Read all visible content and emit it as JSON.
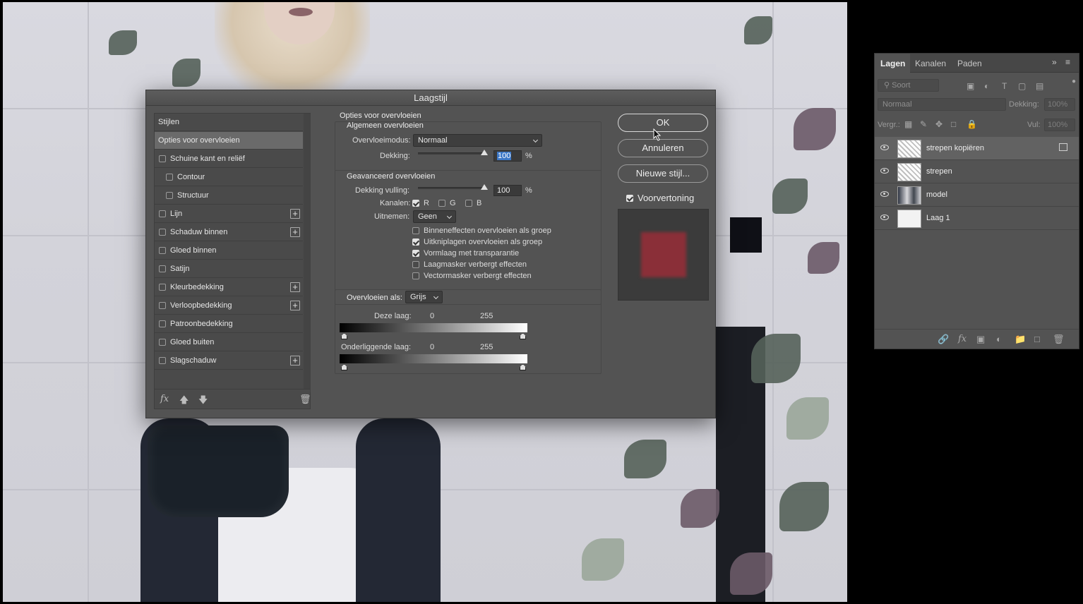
{
  "dialog": {
    "title": "Laagstijl",
    "styles": {
      "header": "Stijlen",
      "items": [
        {
          "label": "Opties voor overvloeien",
          "selected": true
        },
        {
          "label": "Schuine kant en reliëf",
          "checked": false
        },
        {
          "label": "Contour",
          "checked": false
        },
        {
          "label": "Structuur",
          "checked": false
        },
        {
          "label": "Lijn",
          "checked": false
        },
        {
          "label": "Schaduw binnen",
          "checked": false
        },
        {
          "label": "Gloed binnen",
          "checked": false
        },
        {
          "label": "Satijn",
          "checked": false
        },
        {
          "label": "Kleurbedekking",
          "checked": false
        },
        {
          "label": "Verloopbedekking",
          "checked": false
        },
        {
          "label": "Patroonbedekking",
          "checked": false
        },
        {
          "label": "Gloed buiten",
          "checked": false
        },
        {
          "label": "Slagschaduw",
          "checked": false
        }
      ],
      "footer_icons": [
        "fx-icon",
        "move-up-icon",
        "move-down-icon",
        "trash-icon"
      ],
      "fx_label": "fx"
    },
    "options": {
      "section_title": "Opties voor overvloeien",
      "general": {
        "title": "Algemeen overvloeien",
        "blend_mode_label": "Overvloeimodus:",
        "blend_mode_value": "Normaal",
        "opacity_label": "Dekking:",
        "opacity_value": "100",
        "opacity_unit": "%"
      },
      "advanced": {
        "title": "Geavanceerd overvloeien",
        "fill_opacity_label": "Dekking vulling:",
        "fill_opacity_value": "100",
        "fill_opacity_unit": "%",
        "channels_label": "Kanalen:",
        "channels": [
          {
            "label": "R",
            "checked": true
          },
          {
            "label": "G",
            "checked": false
          },
          {
            "label": "B",
            "checked": false
          }
        ],
        "knockout_label": "Uitnemen:",
        "knockout_value": "Geen",
        "checkboxes": [
          {
            "label": "Binneneffecten overvloeien als groep",
            "checked": false
          },
          {
            "label": "Uitkniplagen overvloeien als groep",
            "checked": true
          },
          {
            "label": "Vormlaag met transparantie",
            "checked": true
          },
          {
            "label": "Laagmasker verbergt effecten",
            "checked": false
          },
          {
            "label": "Vectormasker verbergt effecten",
            "checked": false
          }
        ]
      },
      "blend_if": {
        "label": "Overvloeien als:",
        "value": "Grijs",
        "this_layer_label": "Deze laag:",
        "this_layer_min": "0",
        "this_layer_max": "255",
        "underlying_label": "Onderliggende laag:",
        "underlying_min": "0",
        "underlying_max": "255"
      }
    },
    "buttons": {
      "ok": "OK",
      "cancel": "Annuleren",
      "new_style": "Nieuwe stijl..."
    },
    "preview": {
      "label": "Voorvertoning",
      "checked": true,
      "swatch_color": "#8a2f38"
    }
  },
  "layers_panel": {
    "tabs": [
      "Lagen",
      "Kanalen",
      "Paden"
    ],
    "active_tab": "Lagen",
    "filter_placeholder": "Soort",
    "blend_mode": "Normaal",
    "opacity_label": "Dekking:",
    "opacity_value": "100%",
    "lock_label": "Vergr.:",
    "fill_label": "Vul:",
    "fill_value": "100%",
    "layers": [
      {
        "name": "strepen kopiëren",
        "selected": true,
        "thumb": "pattern"
      },
      {
        "name": "strepen",
        "selected": false,
        "thumb": "pattern"
      },
      {
        "name": "model",
        "selected": false,
        "thumb": "model"
      },
      {
        "name": "Laag 1",
        "selected": false,
        "thumb": "white"
      }
    ],
    "footer_icons": [
      "link-icon",
      "fx-icon",
      "mask-icon",
      "adjustment-icon",
      "folder-icon",
      "new-layer-icon",
      "trash-icon"
    ]
  }
}
